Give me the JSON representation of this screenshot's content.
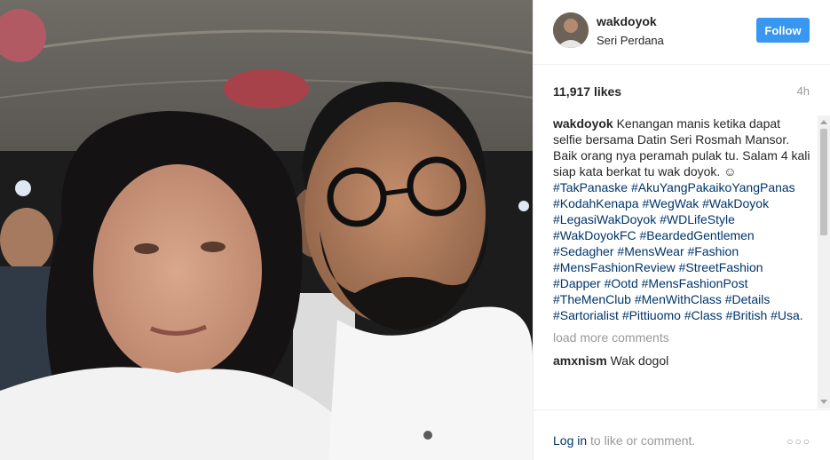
{
  "post": {
    "author": "wakdoyok",
    "location": "Seri Perdana",
    "follow_label": "Follow",
    "likes": "11,917 likes",
    "time_ago": "4h"
  },
  "caption": {
    "user": "wakdoyok",
    "text": "Kenangan manis ketika dapat selfie bersama Datin Seri Rosmah Mansor. Baik orang nya peramah pulak tu. Salam 4 kali siap kata berkat tu wak doyok. ☺",
    "hashtags": [
      "#TakPanaske",
      "#AkuYangPakaikoYangPanas",
      "#KodahKenapa",
      "#WegWak",
      "#WakDoyok",
      "#LegasiWakDoyok",
      "#WDLifeStyle",
      "#WakDoyokFC",
      "#BeardedGentlemen",
      "#Sedagher",
      "#MensWear",
      "#Fashion",
      "#MensFashionReview",
      "#StreetFashion",
      "#Dapper",
      "#Ootd",
      "#MensFashionPost",
      "#TheMenClub",
      "#MenWithClass",
      "#Details",
      "#Sartorialist",
      "#Pittiuomo",
      "#Class",
      "#British",
      "#Usa."
    ]
  },
  "load_more_label": "load more comments",
  "comments": [
    {
      "user": "amxnism",
      "text": "Wak dogol"
    }
  ],
  "footer": {
    "login_link": "Log in",
    "login_suffix": "to like or comment.",
    "more_symbol": "○○○"
  },
  "colors": {
    "accent": "#3897f0",
    "hashtag": "#003569",
    "muted": "#999999"
  }
}
